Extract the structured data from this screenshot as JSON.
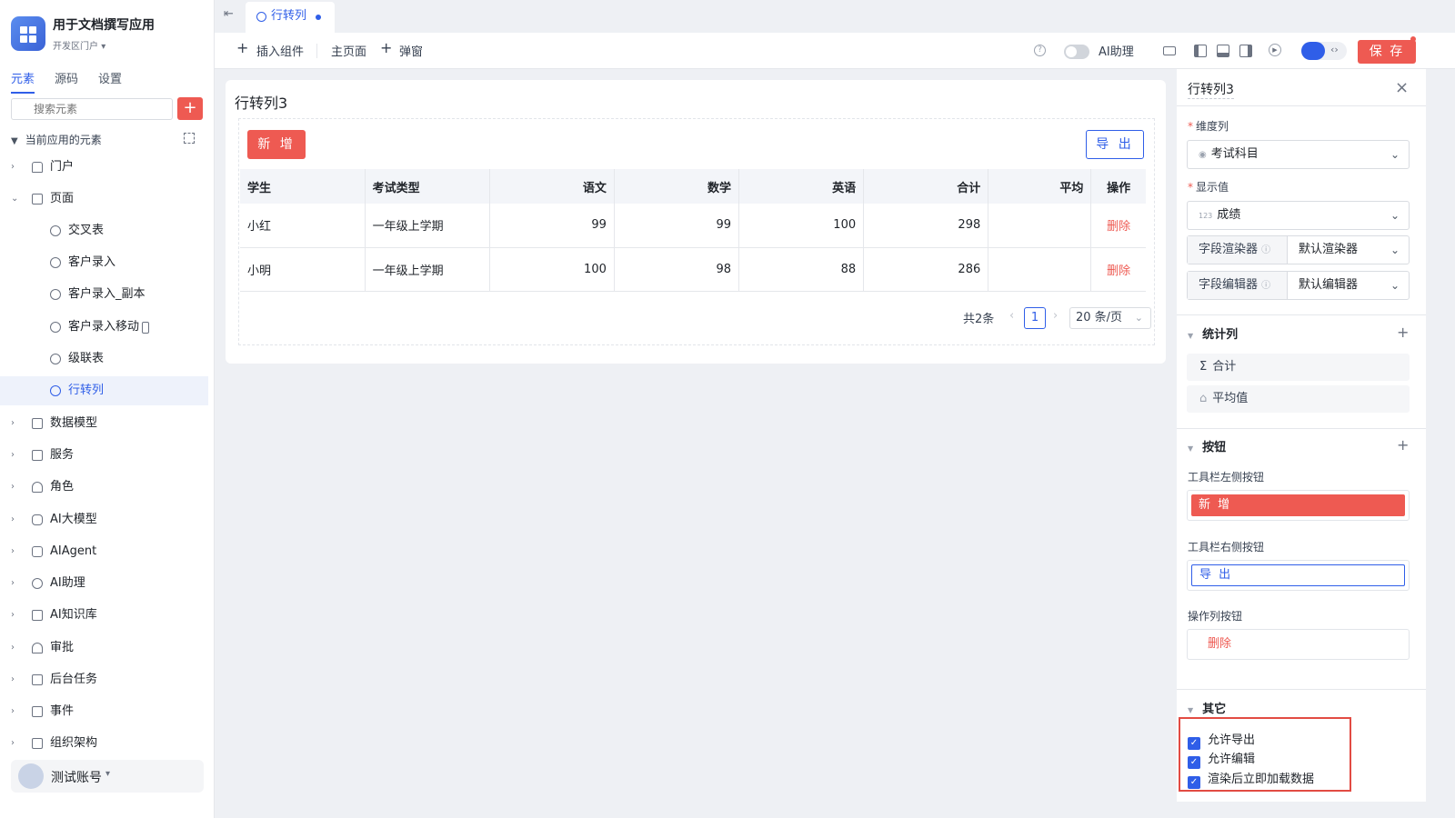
{
  "app": {
    "title": "用于文档撰写应用",
    "subtitle": "开发区门户"
  },
  "sidebar": {
    "tabs": [
      {
        "label": "元素"
      },
      {
        "label": "源码"
      },
      {
        "label": "设置"
      }
    ],
    "search_placeholder": "搜索元素",
    "tree_header": "当前应用的元素",
    "items": [
      {
        "label": "门户"
      },
      {
        "label": "页面"
      },
      {
        "label": "交叉表"
      },
      {
        "label": "客户录入"
      },
      {
        "label": "客户录入_副本"
      },
      {
        "label": "客户录入移动"
      },
      {
        "label": "级联表"
      },
      {
        "label": "行转列"
      },
      {
        "label": "数据模型"
      },
      {
        "label": "服务"
      },
      {
        "label": "角色"
      },
      {
        "label": "AI大模型"
      },
      {
        "label": "AIAgent"
      },
      {
        "label": "AI助理"
      },
      {
        "label": "AI知识库"
      },
      {
        "label": "审批"
      },
      {
        "label": "后台任务"
      },
      {
        "label": "事件"
      },
      {
        "label": "组织架构"
      }
    ],
    "user": {
      "name": "测试账号"
    }
  },
  "tabbar": {
    "active_tab": "行转列"
  },
  "toolbar": {
    "insert_label": "插入组件",
    "main_page_label": "主页面",
    "popup_label": "弹窗",
    "ai_label": "AI助理",
    "save_label": "保 存"
  },
  "card": {
    "title": "行转列3",
    "new_label": "新 增",
    "export_label": "导 出",
    "columns": [
      "学生",
      "考试类型",
      "语文",
      "数学",
      "英语",
      "合计",
      "平均",
      "操作"
    ],
    "rows": [
      {
        "student": "小红",
        "type": "一年级上学期",
        "chinese": "99",
        "math": "99",
        "english": "100",
        "total": "298",
        "avg": "",
        "action": "删除"
      },
      {
        "student": "小明",
        "type": "一年级上学期",
        "chinese": "100",
        "math": "98",
        "english": "88",
        "total": "286",
        "avg": "",
        "action": "删除"
      }
    ],
    "pager": {
      "total": "共2条",
      "page": "1",
      "size": "20 条/页"
    }
  },
  "panel": {
    "title": "行转列3",
    "dimension_label": "维度列",
    "dimension_value": "考试科目",
    "display_label": "显示值",
    "display_value": "成绩",
    "renderer_label": "字段渲染器",
    "renderer_value": "默认渲染器",
    "editor_label": "字段编辑器",
    "editor_value": "默认编辑器",
    "stats_section": "统计列",
    "stat_sum": "合计",
    "stat_avg": "平均值",
    "buttons_section": "按钮",
    "left_btn_label": "工具栏左侧按钮",
    "left_btn_value": "新 增",
    "right_btn_label": "工具栏右侧按钮",
    "right_btn_value": "导 出",
    "action_btn_label": "操作列按钮",
    "action_btn_value": "删除",
    "other_section": "其它",
    "checks": [
      {
        "label": "允许导出"
      },
      {
        "label": "允许编辑"
      },
      {
        "label": "渲染后立即加载数据"
      }
    ]
  },
  "colors": {
    "primary": "#2f5ee8",
    "danger": "#ee5a52"
  }
}
